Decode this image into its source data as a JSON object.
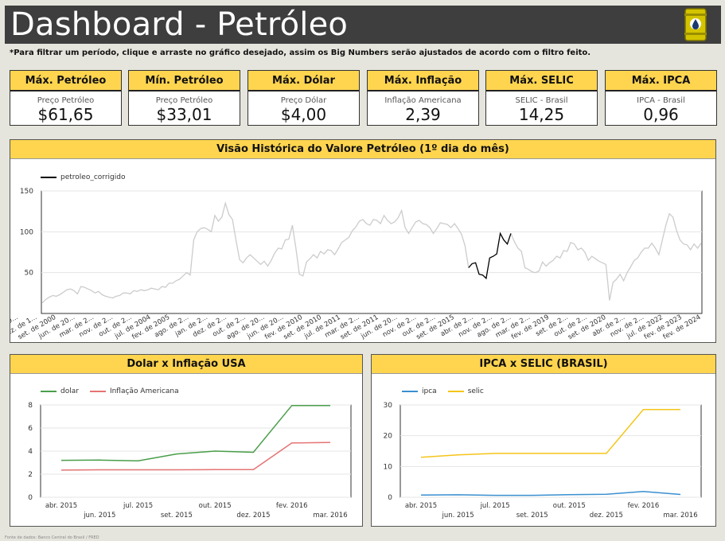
{
  "header": {
    "title": "Dashboard - Petróleo",
    "note": "*Para filtrar um período, clique e arraste no gráfico desejado, assim os Big Numbers serão ajustados de acordo com o filtro feito."
  },
  "cards": [
    {
      "title": "Máx. Petróleo",
      "label": "Preço Petróleo",
      "value": "$61,65"
    },
    {
      "title": "Mín. Petróleo",
      "label": "Preço Petróleo",
      "value": "$33,01"
    },
    {
      "title": "Máx. Dólar",
      "label": "Preço Dólar",
      "value": "$4,00"
    },
    {
      "title": "Máx. Inflação",
      "label": "Inflação Americana",
      "value": "2,39"
    },
    {
      "title": "Máx. SELIC",
      "label": "SELIC - Brasil",
      "value": "14,25"
    },
    {
      "title": "Máx. IPCA",
      "label": "IPCA - Brasil",
      "value": "0,96"
    }
  ],
  "colors": {
    "accent": "#ffd54f",
    "header_bg": "#3e3e3e",
    "background": "#e6e5dd",
    "petroleo_highlight": "#000000",
    "petroleo_muted": "#cccccc",
    "dolar": "#4a9e4a",
    "inflacao": "#e57373",
    "ipca": "#3a8fd0",
    "selic": "#f5c518"
  },
  "icons": {
    "logo": "oil-barrel-icon"
  },
  "chart_data": [
    {
      "type": "line",
      "title": "Visão Histórica do Valore Petróleo (1º dia do mês)",
      "ylim": [
        0,
        150
      ],
      "yticks": [
        50,
        100,
        150
      ],
      "grid": true,
      "legend_position": "top-left",
      "x_tick_labels": [
        "jun. de 19...",
        "dez. de 1...",
        "set. de 2000",
        "jun. de 20...",
        "mar. de 2...",
        "nov. de 2...",
        "out. de 2...",
        "jul. de 2004",
        "fev. de 2005",
        "ago. de 2...",
        "jan. de 2...",
        "dez. de 2...",
        "out. de 2...",
        "ago. de 20...",
        "jun. de 20...",
        "fev. de 2010",
        "set. de 2010",
        "jul. de 2011",
        "mar. de 2...",
        "set. de 2011",
        "jun. de 20...",
        "nov. de 2...",
        "out. de 2...",
        "set. de 2015",
        "abr. de 2...",
        "nov. de 2...",
        "ago. de 2...",
        "mar. de 2...",
        "fev. de 2019",
        "set. de 2...",
        "out. de 2...",
        "set. de 2020",
        "abr. de 2...",
        "nov. de 2...",
        "jul. de 2022",
        "fev. de 2023",
        "fev. de 2024"
      ],
      "series": [
        {
          "name": "petroleo_corrigido",
          "highlight_range": [
            121,
            133
          ],
          "values": [
            13,
            17,
            20,
            22,
            21,
            23,
            26,
            29,
            30,
            28,
            24,
            33,
            32,
            30,
            28,
            25,
            27,
            23,
            21,
            20,
            19,
            21,
            22,
            25,
            25,
            24,
            28,
            27,
            29,
            28,
            29,
            31,
            30,
            29,
            33,
            32,
            37,
            37,
            40,
            42,
            46,
            50,
            47,
            90,
            100,
            104,
            105,
            103,
            100,
            120,
            113,
            118,
            135,
            121,
            115,
            90,
            66,
            62,
            68,
            72,
            68,
            64,
            60,
            64,
            58,
            65,
            74,
            80,
            79,
            90,
            91,
            108,
            80,
            48,
            46,
            63,
            67,
            72,
            68,
            76,
            73,
            78,
            77,
            72,
            79,
            87,
            90,
            93,
            101,
            106,
            113,
            115,
            110,
            108,
            115,
            114,
            110,
            120,
            114,
            110,
            112,
            117,
            126,
            105,
            98,
            105,
            112,
            114,
            110,
            109,
            105,
            98,
            104,
            111,
            110,
            109,
            105,
            110,
            104,
            97,
            83,
            56,
            61,
            62,
            48,
            47,
            43,
            68,
            70,
            73,
            98,
            90,
            85,
            98,
            88,
            80,
            76,
            56,
            54,
            51,
            50,
            52,
            63,
            58,
            62,
            65,
            70,
            68,
            77,
            76,
            87,
            85,
            78,
            80,
            75,
            65,
            70,
            67,
            64,
            62,
            60,
            16,
            38,
            42,
            48,
            40,
            50,
            57,
            65,
            68,
            75,
            80,
            80,
            86,
            80,
            72,
            90,
            108,
            122,
            118,
            102,
            90,
            85,
            84,
            78,
            85,
            80,
            86
          ]
        }
      ]
    },
    {
      "type": "line",
      "title": "Dolar x Inflação USA",
      "ylim": [
        0,
        8
      ],
      "yticks": [
        0,
        2,
        4,
        6,
        8
      ],
      "grid": true,
      "legend_position": "top-left",
      "x_tick_labels": [
        "abr. 2015",
        "jun. 2015",
        "jul. 2015",
        "set. 2015",
        "out. 2015",
        "dez. 2015",
        "fev. 2016",
        "mar. 2016"
      ],
      "series": [
        {
          "name": "dolar",
          "values": [
            3.2,
            3.22,
            3.15,
            3.75,
            4.0,
            3.9,
            7.95,
            7.95
          ]
        },
        {
          "name": "Inflação Americana",
          "values": [
            2.35,
            2.38,
            2.38,
            2.38,
            2.39,
            2.39,
            4.7,
            4.75
          ]
        }
      ]
    },
    {
      "type": "line",
      "title": "IPCA x SELIC (BRASIL)",
      "ylim": [
        0,
        30
      ],
      "yticks": [
        0,
        10,
        20,
        30
      ],
      "grid": true,
      "legend_position": "top-left",
      "x_tick_labels": [
        "abr. 2015",
        "jun. 2015",
        "jul. 2015",
        "set. 2015",
        "out. 2015",
        "dez. 2015",
        "fev. 2016",
        "mar. 2016"
      ],
      "series": [
        {
          "name": "ipca",
          "values": [
            0.71,
            0.79,
            0.62,
            0.62,
            0.82,
            0.96,
            1.9,
            0.9
          ]
        },
        {
          "name": "selic",
          "values": [
            13.0,
            13.75,
            14.25,
            14.25,
            14.25,
            14.25,
            28.5,
            28.5
          ]
        }
      ]
    }
  ],
  "footer": "Fonte de dados: Banco Central do Brasil / FRED"
}
